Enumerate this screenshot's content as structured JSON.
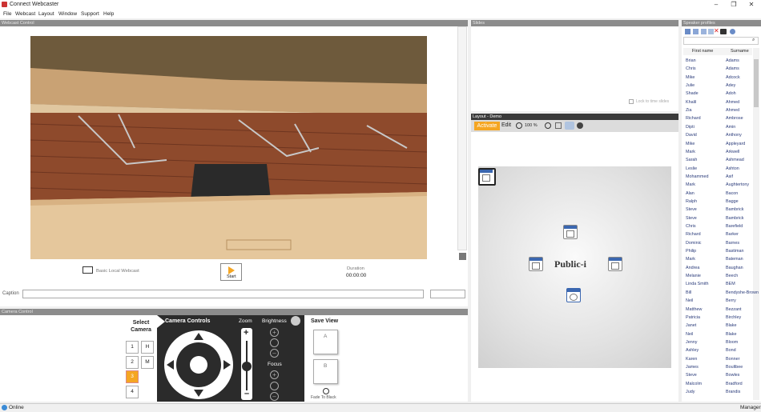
{
  "window": {
    "title": "Connect Webcaster",
    "minimize": "–",
    "maximize": "❐",
    "close": "✕"
  },
  "menu": [
    "File",
    "Webcast",
    "Layout",
    "Window",
    "Support",
    "Help"
  ],
  "webcast_control": {
    "header": "Webcast Control",
    "local_label": "Basic Local Webcast",
    "start_label": "Start",
    "duration_label": "Duration",
    "duration_value": "00:00:00",
    "caption_label": "Caption",
    "caption_value": ""
  },
  "slides": {
    "header": "Slides",
    "lock_label": "Lock to time slides"
  },
  "layout": {
    "header": "Layout - Demo",
    "activate": "Activate",
    "edit": "Edit",
    "zoom": "100 %",
    "logo_text": "Public-i"
  },
  "speakers": {
    "header": "Speaker profiles",
    "col_first": "First name",
    "col_last": "Surname",
    "rows": [
      [
        "Brian",
        "Adams"
      ],
      [
        "Chris",
        "Adams"
      ],
      [
        "Mike",
        "Adcock"
      ],
      [
        "Julie",
        "Adey"
      ],
      [
        "Shade",
        "Adoh"
      ],
      [
        "Khalil",
        "Ahmed"
      ],
      [
        "Zia",
        "Ahmed"
      ],
      [
        "Richard",
        "Ambrose"
      ],
      [
        "Dipti",
        "Amin"
      ],
      [
        "David",
        "Anthony"
      ],
      [
        "Mike",
        "Appleyard"
      ],
      [
        "Mark",
        "Arkwell"
      ],
      [
        "Sarah",
        "Ashmead"
      ],
      [
        "Leslie",
        "Ashton"
      ],
      [
        "Mohammed",
        "Asif"
      ],
      [
        "Mark",
        "Aughtertony"
      ],
      [
        "Alan",
        "Bacon"
      ],
      [
        "Ralph",
        "Bagge"
      ],
      [
        "Steve",
        "Bambrick"
      ],
      [
        "Steve",
        "Bambrick"
      ],
      [
        "Chris",
        "Barefield"
      ],
      [
        "Richard",
        "Barker"
      ],
      [
        "Dominic",
        "Barnes"
      ],
      [
        "Philip",
        "Bastiman"
      ],
      [
        "Mark",
        "Bateman"
      ],
      [
        "Andrea",
        "Baughan"
      ],
      [
        "Melanie",
        "Beech"
      ],
      [
        "Linda Smith",
        "BEM"
      ],
      [
        "Bill",
        "Bendyshe-Brown"
      ],
      [
        "Neil",
        "Berry"
      ],
      [
        "Matthew",
        "Bezzant"
      ],
      [
        "Patricia",
        "Birchley"
      ],
      [
        "Janet",
        "Blake"
      ],
      [
        "Neil",
        "Blake"
      ],
      [
        "Jenny",
        "Bloom"
      ],
      [
        "Ashley",
        "Bond"
      ],
      [
        "Karen",
        "Bonner"
      ],
      [
        "James",
        "Boultbee"
      ],
      [
        "Steve",
        "Bowles"
      ],
      [
        "Malcolm",
        "Bradford"
      ],
      [
        "Judy",
        "Brandis"
      ]
    ]
  },
  "camera_control": {
    "header": "Camera Control",
    "select_camera": "Select Camera",
    "camera_controls": "Camera Controls",
    "zoom": "Zoom",
    "brightness": "Brightness",
    "focus": "Focus",
    "save_view": "Save View",
    "preset_a": "A",
    "preset_b": "B",
    "fade": "Fade To Black",
    "cams": [
      "1",
      "2",
      "3",
      "4"
    ],
    "cam_modes": [
      "H",
      "M"
    ],
    "selected_cam": "3"
  },
  "status": {
    "left": "Online",
    "right": "Manager"
  },
  "colors": {
    "accent_orange": "#f5a623",
    "dark_panel": "#2b2b2b",
    "panel_header": "#8c8c8c"
  }
}
